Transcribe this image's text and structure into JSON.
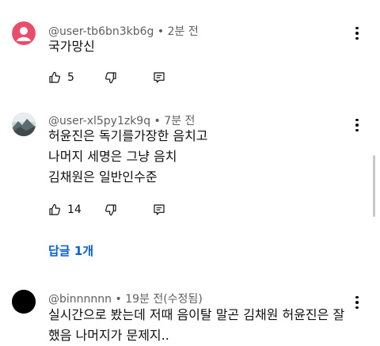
{
  "comments": [
    {
      "author": "@user-tb6bn3kb6g",
      "time": "2분 전",
      "text": "국가망신",
      "likes": "5",
      "avatar_color": "#ea4c6b",
      "avatar_icon": "person-icon"
    },
    {
      "author": "@user-xl5py1zk9q",
      "time": "7분 전",
      "text": "허윤진은 독기를가장한 음치고\n나머지 세명은 그냥  음치\n김채원은 일반인수준",
      "likes": "14",
      "avatar_icon": "landscape-photo",
      "replies_label": "답글 1개"
    },
    {
      "author": "@binnnnnn",
      "time": "19분 전(수정됨)",
      "text": "실시간으로 봤는데 저때 음이탈 말곤 김채원 허윤진은 잘\n했음 나머지가 문제지..",
      "avatar_color": "#000000"
    }
  ],
  "separator": " • ",
  "colors": {
    "link": "#065fd4",
    "meta": "#606060",
    "text": "#0f0f0f"
  }
}
